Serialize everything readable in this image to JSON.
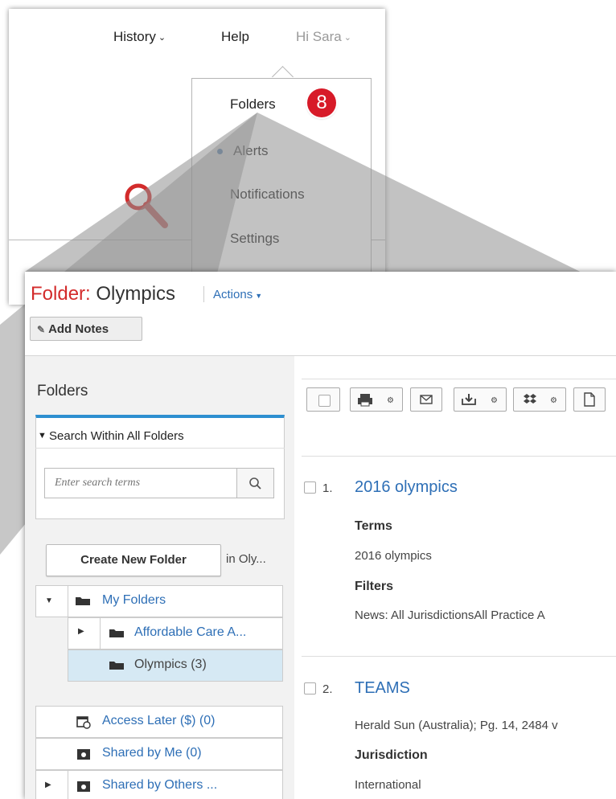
{
  "top_menu": {
    "history": "History",
    "help": "Help",
    "user": "Hi Sara"
  },
  "dropdown": {
    "items": [
      "Folders",
      "Alerts",
      "Notifications",
      "Settings"
    ],
    "badge": "8"
  },
  "folder_page": {
    "title_prefix": "Folder:",
    "title_name": "Olympics",
    "actions": "Actions",
    "add_notes": "Add Notes",
    "sidebar_heading": "Folders",
    "search_within": "Search Within All Folders",
    "search_placeholder": "Enter search terms",
    "create_button": "Create New Folder",
    "create_location": "in Oly...",
    "tree": [
      "My Folders",
      "Affordable Care A...",
      "Olympics (3)"
    ],
    "shared": [
      "Access Later ($) (0)",
      "Shared by Me (0)",
      "Shared by Others ..."
    ]
  },
  "results": [
    {
      "num": "1.",
      "title": "2016 olympics",
      "h1": "Terms",
      "t1": "2016 olympics",
      "h2": "Filters",
      "t2": "News: All JurisdictionsAll Practice A"
    },
    {
      "num": "2.",
      "title": "TEAMS",
      "t1": "Herald Sun (Australia); Pg. 14, 2484 v",
      "h2": "Jurisdiction",
      "t2": "International"
    }
  ],
  "colors": {
    "accent_blue": "#2e6fb6",
    "brand_red": "#d32b2b",
    "badge_red": "#d71a28",
    "overlay_gray": "#8f8f8f"
  }
}
